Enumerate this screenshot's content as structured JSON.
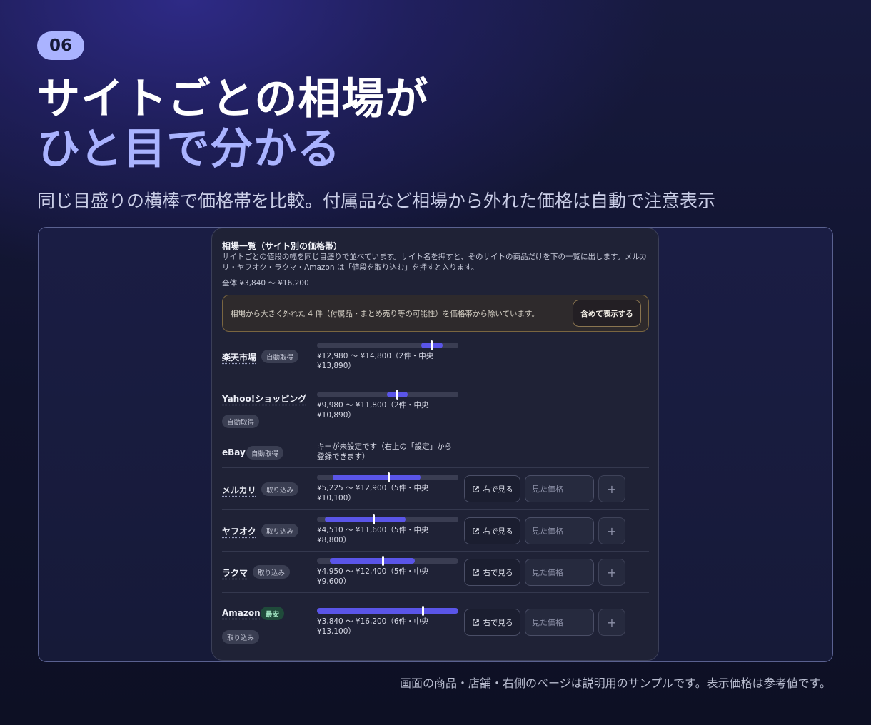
{
  "badge": "06",
  "headline": {
    "line1": "サイトごとの相場が",
    "line2": "ひと目で分かる"
  },
  "subtitle": "同じ目盛りの横棒で価格帯を比較。付属品など相場から外れた価格は自動で注意表示",
  "panel": {
    "title": "相場一覧（サイト別の価格帯）",
    "description": "サイトごとの値段の幅を同じ目盛りで並べています。サイト名を押すと、そのサイトの商品だけを下の一覧に出します。メルカリ・ヤフオク・ラクマ・Amazon は「値段を取り込む」を押すと入ります。",
    "overall_range": "全体 ¥3,840 〜 ¥16,200",
    "scale_min": 3840,
    "scale_max": 16200,
    "alert": {
      "text": "相場から大きく外れた 4 件（付属品・まとめ売り等の可能性）を価格帯から除いています。",
      "button": "含めて表示する"
    },
    "view_button": "右で見る",
    "price_placeholder": "見た価格",
    "add_symbol": "+",
    "sites": [
      {
        "name": "楽天市場",
        "tag": "自動取得",
        "price_line1": "¥12,980 〜 ¥14,800（2件・中央",
        "price_line2": "¥13,890）",
        "min": 12980,
        "max": 14800,
        "median": 13890
      },
      {
        "name": "Yahoo!ショッピング",
        "tag": "自動取得",
        "price_line1": "¥9,980 〜 ¥11,800（2件・中央",
        "price_line2": "¥10,890）",
        "min": 9980,
        "max": 11800,
        "median": 10890
      },
      {
        "name": "eBay",
        "tag": "自動取得",
        "price_line1": "キーが未設定です（右上の「設定」から",
        "price_line2": "登録できます）"
      },
      {
        "name": "メルカリ",
        "tag": "取り込み",
        "price_line1": "¥5,225 〜 ¥12,900（5件・中央",
        "price_line2": "¥10,100）",
        "min": 5225,
        "max": 12900,
        "median": 10100
      },
      {
        "name": "ヤフオク",
        "tag": "取り込み",
        "price_line1": "¥4,510 〜 ¥11,600（5件・中央",
        "price_line2": "¥8,800）",
        "min": 4510,
        "max": 11600,
        "median": 8800
      },
      {
        "name": "ラクマ",
        "tag": "取り込み",
        "price_line1": "¥4,950 〜 ¥12,400（5件・中央",
        "price_line2": "¥9,600）",
        "min": 4950,
        "max": 12400,
        "median": 9600
      },
      {
        "name": "Amazon",
        "tag": "最安",
        "tag2": "取り込み",
        "price_line1": "¥3,840 〜 ¥16,200（6件・中央",
        "price_line2": "¥13,100）",
        "min": 3840,
        "max": 16200,
        "median": 13100
      }
    ]
  },
  "footnote": "画面の商品・店舗・右側のページは説明用のサンプルです。表示価格は参考値です。",
  "colors": {
    "accent": "#aab3ff",
    "bar_fill": "#5a55e8",
    "lowest_tag": "#1f4a3a"
  }
}
